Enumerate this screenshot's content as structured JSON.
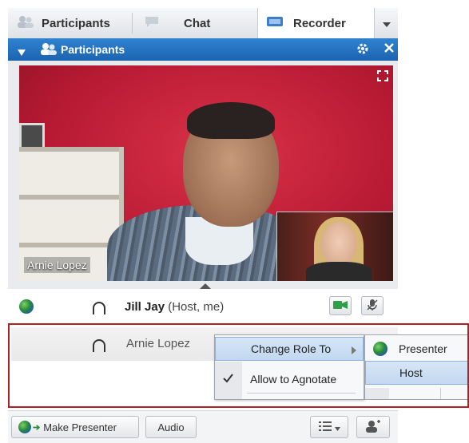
{
  "tabs": [
    {
      "label": "Participants"
    },
    {
      "label": "Chat"
    },
    {
      "label": "Recorder"
    }
  ],
  "panel": {
    "title": "Participants"
  },
  "video": {
    "main_speaker_name": "Arnie Lopez"
  },
  "participants": [
    {
      "name": "Jill Jay",
      "role": "(Host, me)"
    },
    {
      "name": "Arnie Lopez",
      "role": ""
    }
  ],
  "context_menu": {
    "items": [
      {
        "label": "Change Role To",
        "highlighted": true
      },
      {
        "label": "Allow to Agnotate",
        "checked": true
      }
    ],
    "submenu": [
      {
        "label": "Presenter",
        "icon": "globe-icon"
      },
      {
        "label": "Host",
        "highlighted": true
      }
    ]
  },
  "toolbar": {
    "make_presenter": "Make Presenter",
    "audio": "Audio"
  },
  "colors": {
    "header_blue": "#1f6bb8",
    "highlight_box": "#b32024",
    "menu_highlight": "#c8dcf2"
  }
}
